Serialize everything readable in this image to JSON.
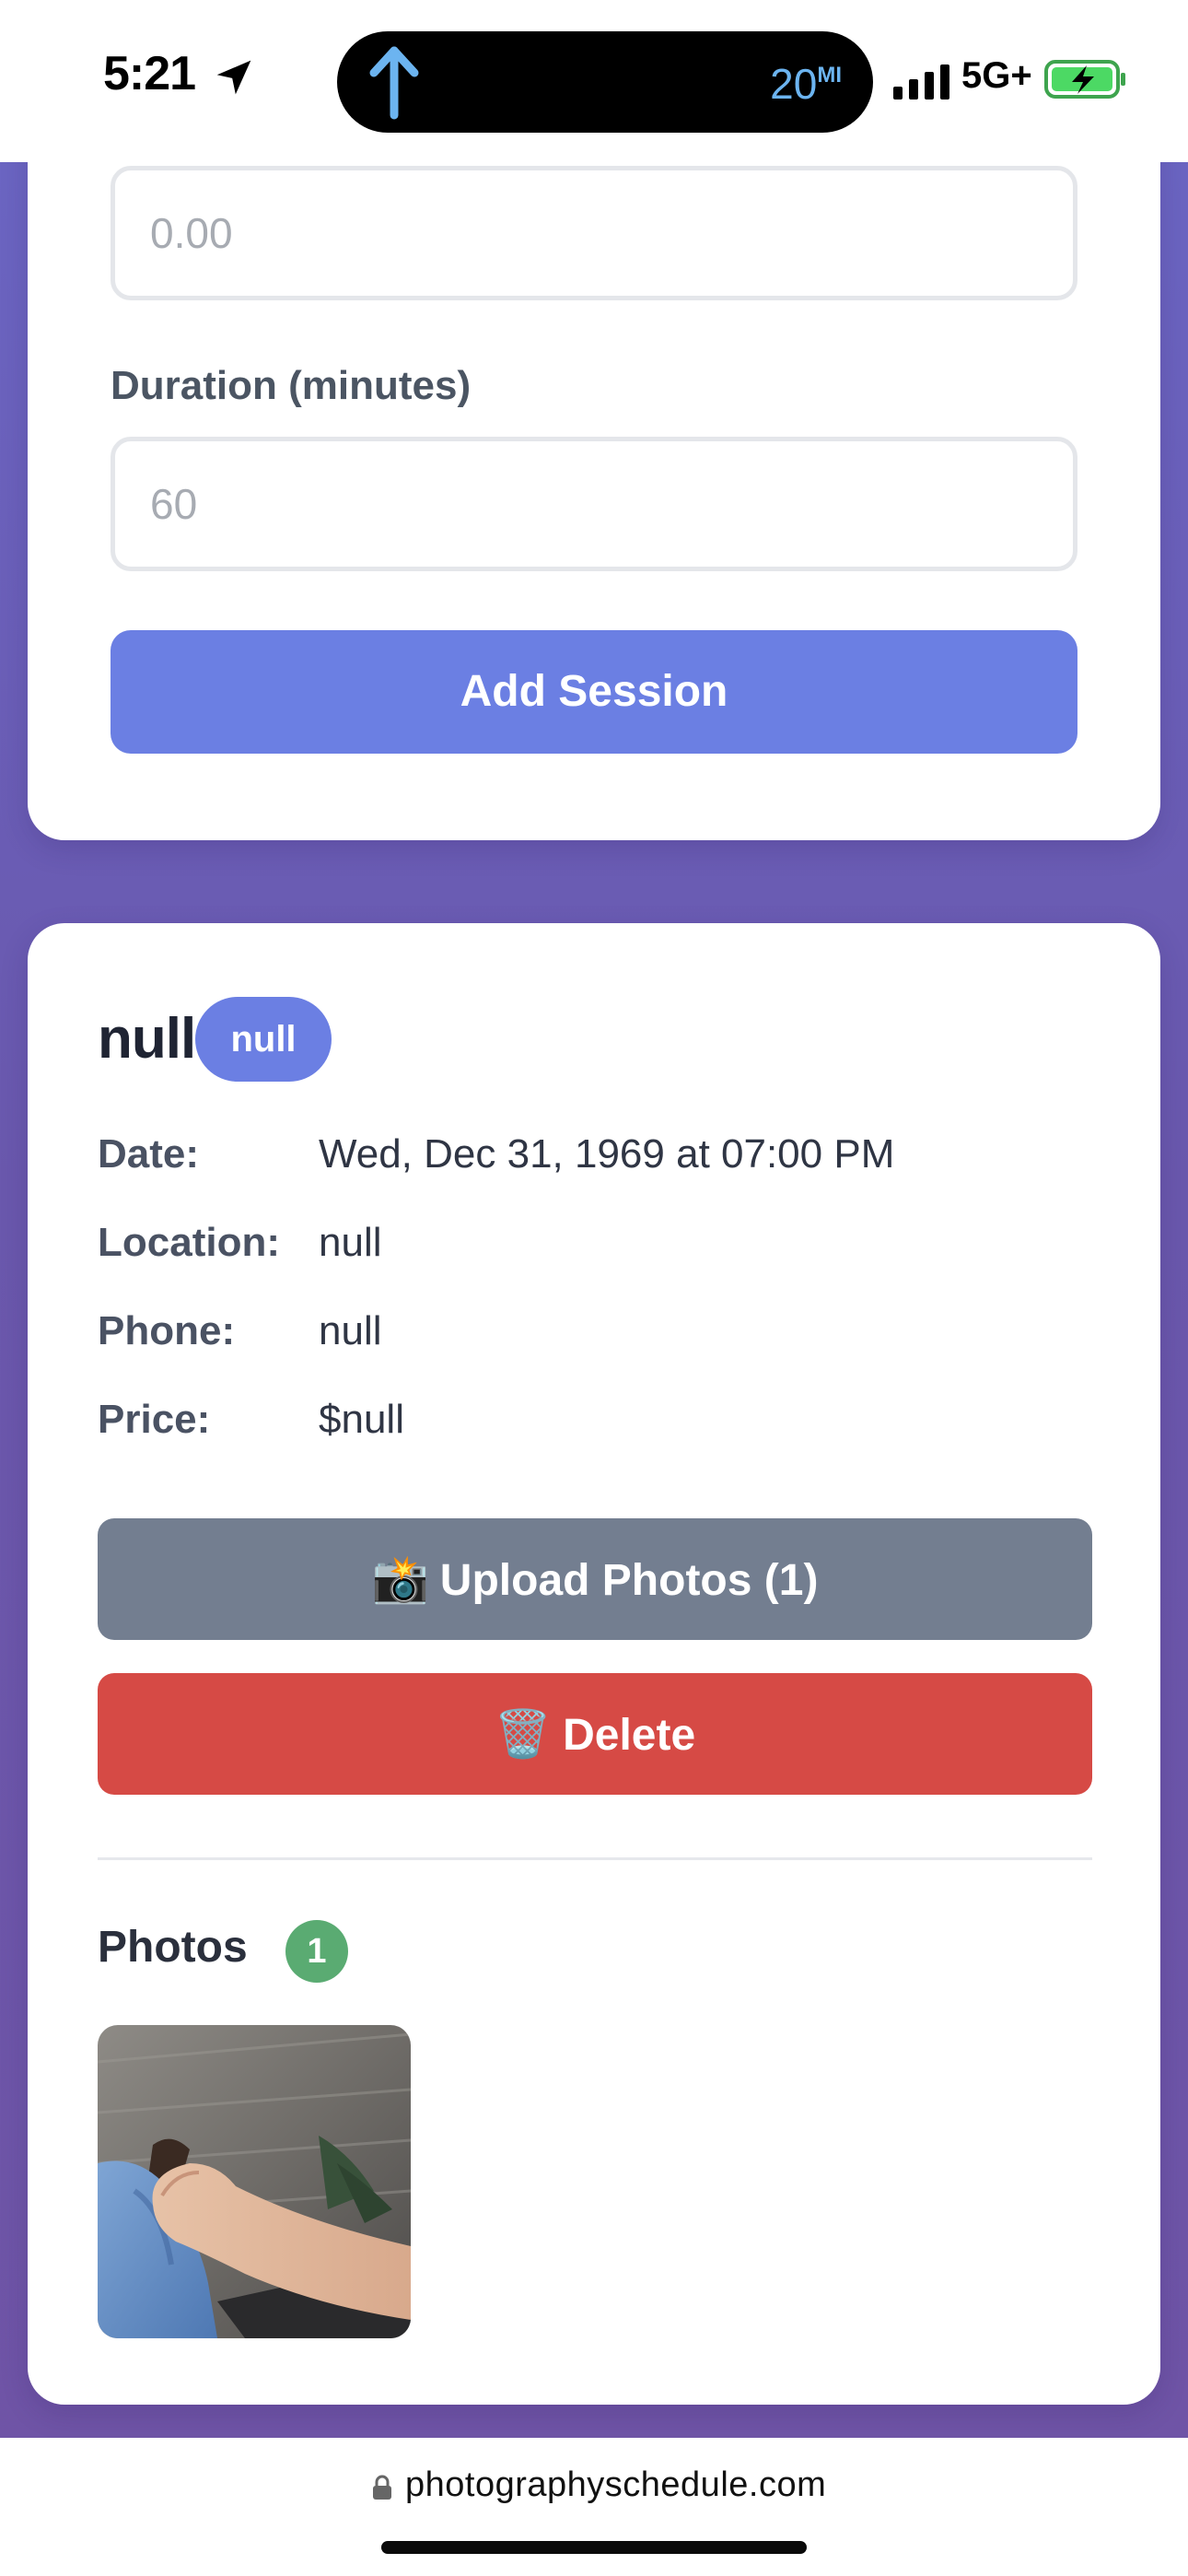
{
  "status_bar": {
    "time": "5:21",
    "island_distance": "20",
    "island_distance_unit": "MI",
    "network": "5G+"
  },
  "form": {
    "price_placeholder": "0.00",
    "duration_label": "Duration (minutes)",
    "duration_placeholder": "60",
    "submit_label": "Add Session"
  },
  "session": {
    "title": "null",
    "badge": "null",
    "details": [
      {
        "label": "Date:",
        "value": "Wed, Dec 31, 1969 at 07:00 PM"
      },
      {
        "label": "Location:",
        "value": "null"
      },
      {
        "label": "Phone:",
        "value": "null"
      },
      {
        "label": "Price:",
        "value": "$null"
      }
    ],
    "upload_icon": "📸",
    "upload_label": "Upload Photos (1)",
    "delete_icon": "🗑️",
    "delete_label": "Delete",
    "photos_heading": "Photos",
    "photos_count": "1"
  },
  "browser": {
    "url": "photographyschedule.com"
  },
  "colors": {
    "accent": "#6b7fe3",
    "background_purple": "#6a58ad",
    "upload_button": "#737e90",
    "delete_button": "#d64a45",
    "count_badge": "#5aab72"
  },
  "icons": {
    "location": "location-arrow-icon",
    "navigation": "navigation-up-arrow-icon",
    "signal": "cellular-signal-icon",
    "battery": "battery-charging-icon",
    "lock": "lock-icon"
  }
}
